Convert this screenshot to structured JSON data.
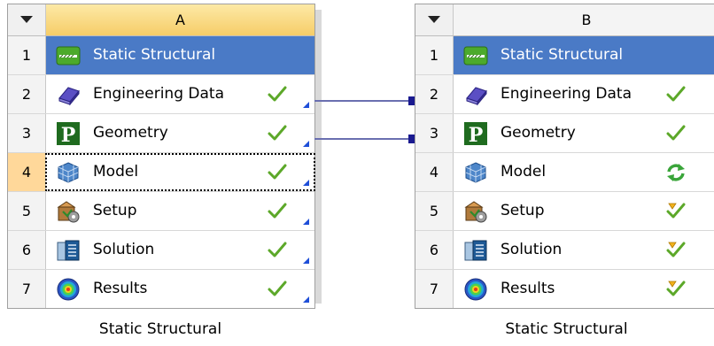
{
  "systems": [
    {
      "column": "A",
      "caption": "Static Structural",
      "rows": [
        {
          "num": "1",
          "label": "Static Structural",
          "icon": "static-structural-icon"
        },
        {
          "num": "2",
          "label": "Engineering Data",
          "icon": "engineering-data-icon",
          "state": "up-to-date"
        },
        {
          "num": "3",
          "label": "Geometry",
          "icon": "geometry-icon",
          "state": "up-to-date"
        },
        {
          "num": "4",
          "label": "Model",
          "icon": "model-icon",
          "state": "up-to-date"
        },
        {
          "num": "5",
          "label": "Setup",
          "icon": "setup-icon",
          "state": "up-to-date"
        },
        {
          "num": "6",
          "label": "Solution",
          "icon": "solution-icon",
          "state": "up-to-date"
        },
        {
          "num": "7",
          "label": "Results",
          "icon": "results-icon",
          "state": "up-to-date"
        }
      ]
    },
    {
      "column": "B",
      "caption": "Static Structural",
      "rows": [
        {
          "num": "1",
          "label": "Static Structural",
          "icon": "static-structural-icon"
        },
        {
          "num": "2",
          "label": "Engineering Data",
          "icon": "engineering-data-icon",
          "state": "up-to-date"
        },
        {
          "num": "3",
          "label": "Geometry",
          "icon": "geometry-icon",
          "state": "up-to-date"
        },
        {
          "num": "4",
          "label": "Model",
          "icon": "model-icon",
          "state": "refresh-required"
        },
        {
          "num": "5",
          "label": "Setup",
          "icon": "setup-icon",
          "state": "update-required"
        },
        {
          "num": "6",
          "label": "Solution",
          "icon": "solution-icon",
          "state": "update-required"
        },
        {
          "num": "7",
          "label": "Results",
          "icon": "results-icon",
          "state": "update-required"
        }
      ]
    }
  ],
  "colors": {
    "title_bg": "#4a7ac6",
    "header_a": "#f6cd68",
    "selected_row_num": "#ffd89a",
    "link_line": "#6a6fb0",
    "check": "#5ca829",
    "corner_arrow": "#1f4fd8"
  }
}
